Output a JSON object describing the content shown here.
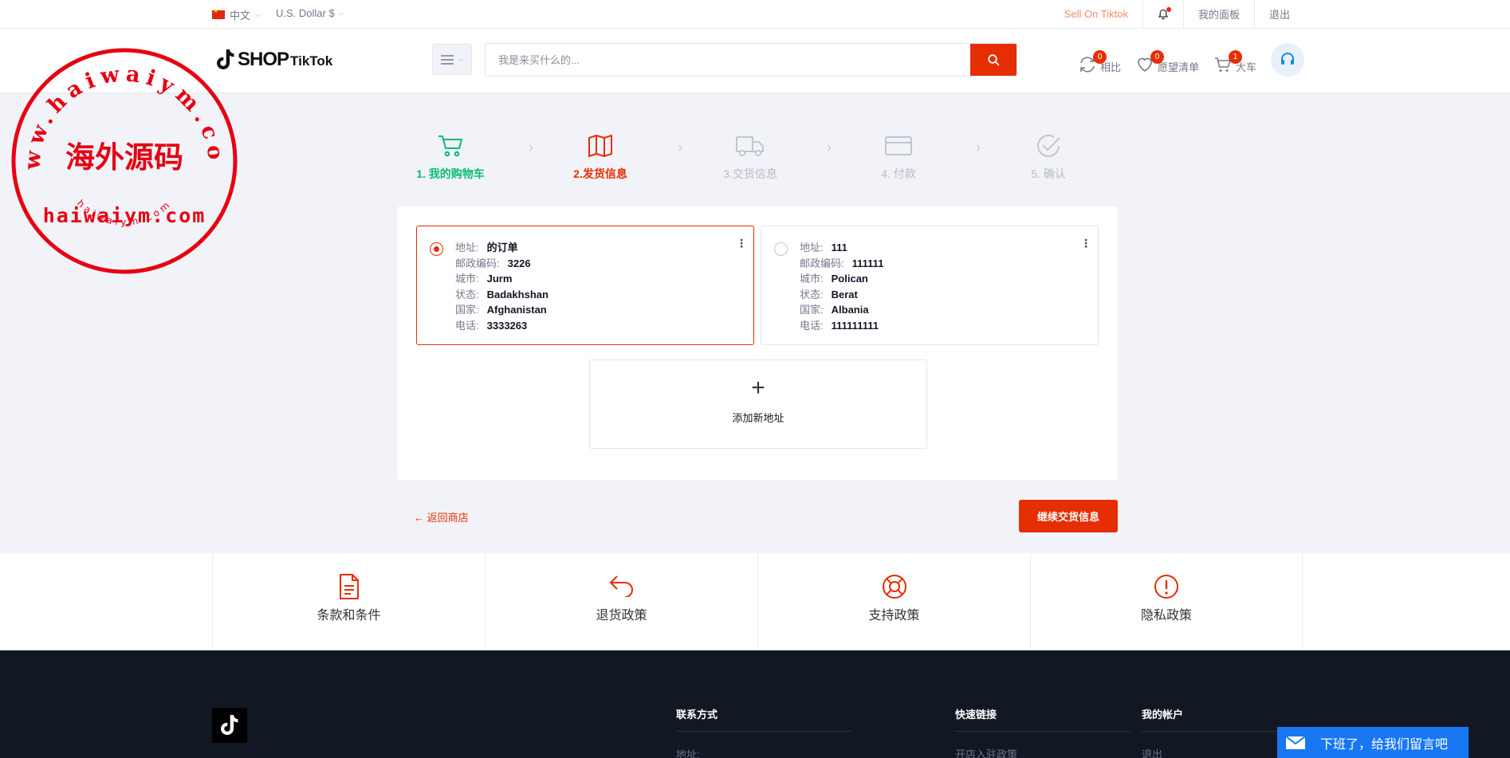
{
  "topbar": {
    "language": "中文",
    "currency": "U.S. Dollar $",
    "sell_link": "Sell On Tiktok",
    "dashboard": "我的面板",
    "logout": "退出"
  },
  "header": {
    "logo_shop": "SHOP",
    "logo_tiktok": "TikTok",
    "search_placeholder": "我是来买什么的...",
    "compare": {
      "label": "相比",
      "count": "0"
    },
    "wishlist": {
      "label": "愿望清单",
      "count": "0"
    },
    "cart": {
      "label": "大车",
      "count": "1"
    }
  },
  "steps": [
    {
      "label": "1. 我的购物车",
      "state": "done"
    },
    {
      "label": "2.发货信息",
      "state": "active"
    },
    {
      "label": "3.交货信息",
      "state": "todo"
    },
    {
      "label": "4. 付款",
      "state": "todo"
    },
    {
      "label": "5. 确认",
      "state": "todo"
    }
  ],
  "field_labels": {
    "address": "地址:",
    "postal": "邮政编码:",
    "city": "城市:",
    "state": "状态:",
    "country": "国家:",
    "phone": "电话:"
  },
  "addresses": [
    {
      "address": "的订单",
      "postal": "3226",
      "city": "Jurm",
      "state": "Badakhshan",
      "country": "Afghanistan",
      "phone": "3333263",
      "selected": true
    },
    {
      "address": "111",
      "postal": "111111",
      "city": "Polican",
      "state": "Berat",
      "country": "Albania",
      "phone": "111111111",
      "selected": false
    }
  ],
  "add_address": {
    "plus": "+",
    "label": "添加新地址"
  },
  "actions": {
    "back": "← 返回商店",
    "continue": "继续交货信息"
  },
  "policies": [
    {
      "label": "条款和条件",
      "icon": "document-icon"
    },
    {
      "label": "退货政策",
      "icon": "return-icon"
    },
    {
      "label": "支持政策",
      "icon": "lifebuoy-icon"
    },
    {
      "label": "隐私政策",
      "icon": "alert-circle-icon"
    }
  ],
  "footer": {
    "contact": {
      "title": "联系方式",
      "item": "地址:"
    },
    "quick_links": {
      "title": "快速链接",
      "item": "开店入驻政策"
    },
    "account": {
      "title": "我的帐户",
      "item": "退出"
    }
  },
  "chat": {
    "label": "下班了，给我们留言吧"
  },
  "watermark": {
    "top_text": "www.haiwaiym.com",
    "center_text": "海外源码",
    "middle_text": "haiwaiym.com",
    "bottom_text": "haiwaiym.com"
  },
  "colors": {
    "accent": "#e62e04",
    "success": "#0abb75",
    "footer_bg": "#111723",
    "chat_bg": "#1877f2"
  }
}
